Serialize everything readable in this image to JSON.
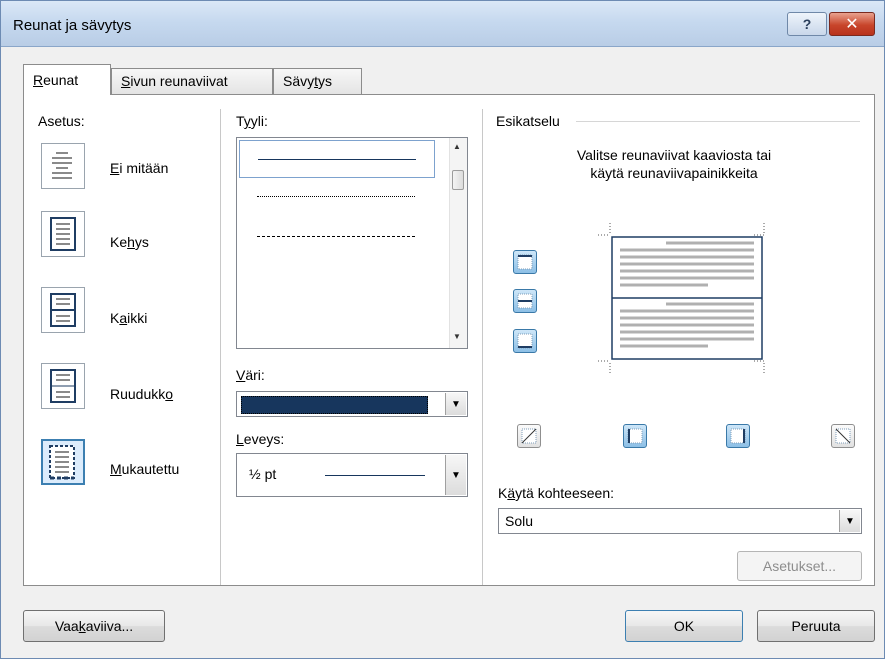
{
  "window": {
    "title": "Reunat ja sävytys",
    "help_glyph": "?",
    "close_glyph": "✕"
  },
  "tabs": [
    {
      "pre": "",
      "u": "R",
      "post": "eunat",
      "active": true
    },
    {
      "pre": "",
      "u": "S",
      "post": "ivun reunaviivat",
      "active": false
    },
    {
      "pre": "Sävy",
      "u": "t",
      "post": "ys",
      "active": false
    }
  ],
  "setting": {
    "label": "Asetus:",
    "items": [
      {
        "pre": "",
        "u": "E",
        "post": "i mitään",
        "selected": false
      },
      {
        "pre": "Ke",
        "u": "h",
        "post": "ys",
        "selected": false
      },
      {
        "pre": "K",
        "u": "a",
        "post": "ikki",
        "selected": false
      },
      {
        "pre": "Ruudukk",
        "u": "o",
        "post": "",
        "selected": false
      },
      {
        "pre": "",
        "u": "M",
        "post": "ukautettu",
        "selected": true
      }
    ]
  },
  "style": {
    "label_pre": "T",
    "label_u": "y",
    "label_post": "yli:",
    "items": [
      "solid",
      "dotted",
      "dashed-small",
      "dashed",
      "dash-dot"
    ],
    "selected_index": 0
  },
  "color": {
    "label_u": "V",
    "label_post": "äri:",
    "value": "#17365d"
  },
  "width": {
    "label_u": "L",
    "label_post": "eveys:",
    "value": "½ pt"
  },
  "preview": {
    "label": "Esikatselu",
    "instruction_line1": "Valitse reunaviivat kaaviosta tai",
    "instruction_line2": "käytä reunaviivapainikkeita"
  },
  "apply_to": {
    "label_pre": "K",
    "label_u": "ä",
    "label_post": "ytä kohteeseen:",
    "value": "Solu"
  },
  "buttons": {
    "options": "Asetukset...",
    "horizontal_pre": "Vaa",
    "horizontal_u": "k",
    "horizontal_post": "aviiva...",
    "ok": "OK",
    "cancel": "Peruuta"
  },
  "colors": {
    "accent": "#3c7fb1",
    "selection_fill": "#dcecfc"
  }
}
